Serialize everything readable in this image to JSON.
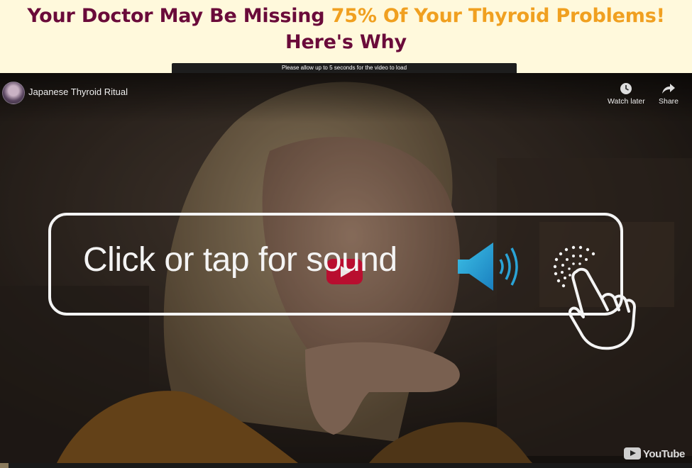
{
  "headline": {
    "part1": "Your Doctor May Be Missing ",
    "highlight": "75% Of Your Thyroid Problems!",
    "line2": "Here's Why"
  },
  "video": {
    "load_notice": "Please allow up to 5 seconds for the video to load",
    "channel_title": "Japanese Thyroid Ritual",
    "watch_later": "Watch later",
    "share": "Share",
    "sound_prompt": "Click or tap for sound",
    "youtube_logo": "YouTube"
  },
  "colors": {
    "headline": "#6a0b3a",
    "highlight": "#f0a020",
    "background": "#fff9dc",
    "speaker": "#2aa3d6"
  },
  "icons": [
    "clock-icon",
    "share-arrow-icon",
    "speaker-icon",
    "tap-hand-icon",
    "youtube-play-icon"
  ]
}
